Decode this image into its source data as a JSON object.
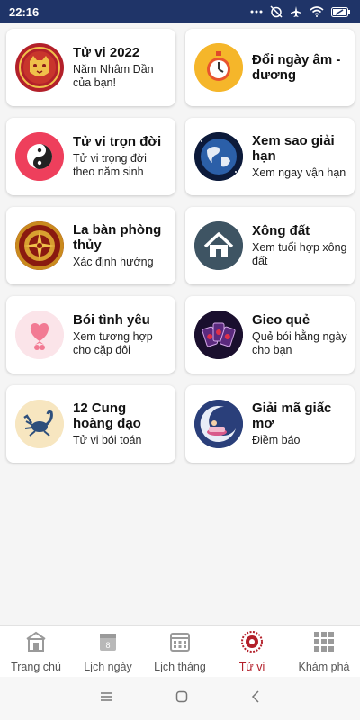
{
  "status_bar": {
    "time": "22:16"
  },
  "cards": [
    {
      "title": "Tử vi 2022",
      "subtitle": "Năm Nhâm Dần của bạn!",
      "icon": "tiger-icon"
    },
    {
      "title": "Đổi ngày âm - dương",
      "subtitle": "",
      "icon": "stopwatch-icon"
    },
    {
      "title": "Tử vi trọn đời",
      "subtitle": "Tử vi trọng đời theo năm sinh",
      "icon": "yin-yang-icon"
    },
    {
      "title": "Xem sao giải hạn",
      "subtitle": "Xem ngay vận hạn",
      "icon": "earth-icon"
    },
    {
      "title": "La bàn phòng thủy",
      "subtitle": "Xác định hướng",
      "icon": "compass-icon"
    },
    {
      "title": "Xông đất",
      "subtitle": "Xem tuổi hợp xông đất",
      "icon": "house-icon"
    },
    {
      "title": "Bói tình yêu",
      "subtitle": "Xem tương hợp cho cặp đôi",
      "icon": "heart-balloon-icon"
    },
    {
      "title": "Gieo quẻ",
      "subtitle": "Quẻ bói hằng ngày cho bạn",
      "icon": "tarot-cards-icon"
    },
    {
      "title": "12 Cung hoàng đạo",
      "subtitle": "Tử vi bói toán",
      "icon": "scorpio-icon"
    },
    {
      "title": "Giải mã giấc mơ",
      "subtitle": "Điềm báo",
      "icon": "dream-moon-icon"
    }
  ],
  "bottom_nav": {
    "items": [
      {
        "label": "Trang chủ",
        "icon": "home-icon"
      },
      {
        "label": "Lịch ngày",
        "icon": "calendar-day-icon",
        "day": "8"
      },
      {
        "label": "Lịch tháng",
        "icon": "calendar-month-icon"
      },
      {
        "label": "Tử vi",
        "icon": "zodiac-icon"
      },
      {
        "label": "Khám phá",
        "icon": "grid-icon"
      }
    ],
    "active_index": 3
  },
  "colors": {
    "status_bar": "#1f3468",
    "active_nav": "#b3202a",
    "inactive_nav": "#9a9a9a"
  }
}
